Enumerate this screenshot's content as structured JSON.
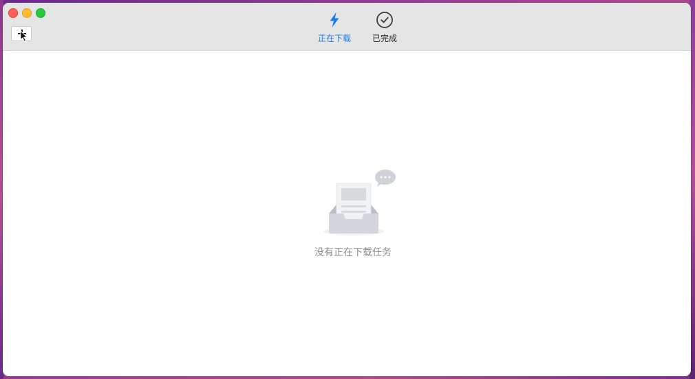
{
  "window": {
    "title": ""
  },
  "toolbar": {
    "add_button": {
      "icon": "plus-icon"
    }
  },
  "tabs": [
    {
      "id": "downloading",
      "label": "正在下载",
      "icon": "lightning-icon",
      "active": true
    },
    {
      "id": "completed",
      "label": "已完成",
      "icon": "checkmark-circle-icon",
      "active": false
    }
  ],
  "empty_state": {
    "message": "没有正在下载任务",
    "icon": "empty-inbox-icon"
  },
  "colors": {
    "accent": "#1d7cf2",
    "titlebar": "#e4e5e4",
    "text_muted": "#8e8e8e"
  }
}
